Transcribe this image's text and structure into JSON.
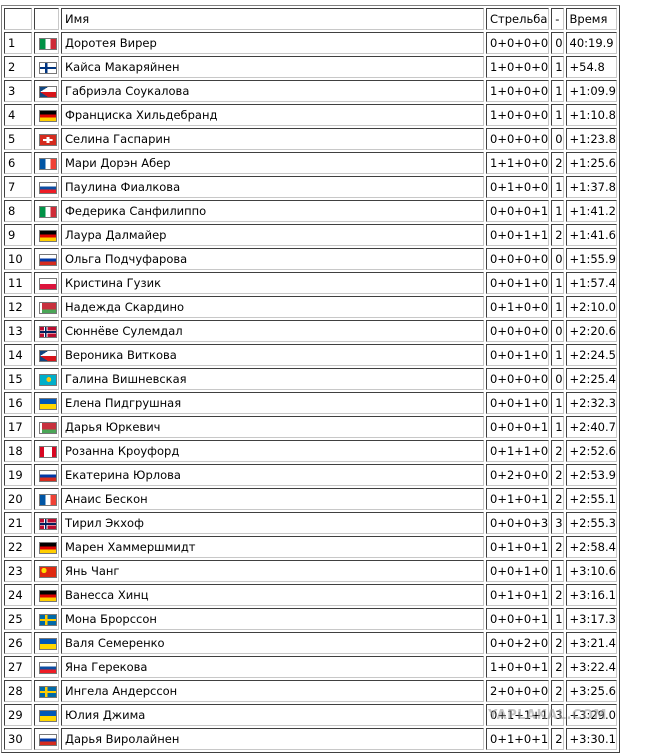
{
  "headers": {
    "place": "",
    "flag": "",
    "name": "Имя",
    "shooting": "Стрельба",
    "penalty": "-",
    "time": "Время"
  },
  "rows": [
    {
      "place": "1",
      "flag": "ITA",
      "name": "Доротея Вирер",
      "shooting": "0+0+0+0",
      "penalty": "0",
      "time": "40:19.9"
    },
    {
      "place": "2",
      "flag": "FIN",
      "name": "Кайса Макаряйнен",
      "shooting": "1+0+0+0",
      "penalty": "1",
      "time": "+54.8"
    },
    {
      "place": "3",
      "flag": "CZE",
      "name": "Габриэла Соукалова",
      "shooting": "1+0+0+0",
      "penalty": "1",
      "time": "+1:09.9"
    },
    {
      "place": "4",
      "flag": "GER",
      "name": "Франциска Хильдебранд",
      "shooting": "1+0+0+0",
      "penalty": "1",
      "time": "+1:10.8"
    },
    {
      "place": "5",
      "flag": "SUI",
      "name": "Селина Гаспарин",
      "shooting": "0+0+0+0",
      "penalty": "0",
      "time": "+1:23.8"
    },
    {
      "place": "6",
      "flag": "FRA",
      "name": "Мари Дорэн Абер",
      "shooting": "1+1+0+0",
      "penalty": "2",
      "time": "+1:25.6"
    },
    {
      "place": "7",
      "flag": "SVK",
      "name": "Паулина Фиалкова",
      "shooting": "0+1+0+0",
      "penalty": "1",
      "time": "+1:37.8"
    },
    {
      "place": "8",
      "flag": "ITA",
      "name": "Федерика Санфилиппо",
      "shooting": "0+0+0+1",
      "penalty": "1",
      "time": "+1:41.2"
    },
    {
      "place": "9",
      "flag": "GER",
      "name": "Лаура Далмайер",
      "shooting": "0+0+1+1",
      "penalty": "2",
      "time": "+1:41.6"
    },
    {
      "place": "10",
      "flag": "RUS",
      "name": "Ольга Подчуфарова",
      "shooting": "0+0+0+0",
      "penalty": "0",
      "time": "+1:55.9"
    },
    {
      "place": "11",
      "flag": "POL",
      "name": "Кристина Гузик",
      "shooting": "0+0+1+0",
      "penalty": "1",
      "time": "+1:57.4"
    },
    {
      "place": "12",
      "flag": "BLR",
      "name": "Надежда Скардино",
      "shooting": "0+1+0+0",
      "penalty": "1",
      "time": "+2:10.0"
    },
    {
      "place": "13",
      "flag": "NOR",
      "name": "Сюннёве Сулемдал",
      "shooting": "0+0+0+0",
      "penalty": "0",
      "time": "+2:20.6"
    },
    {
      "place": "14",
      "flag": "CZE",
      "name": "Вероника Виткова",
      "shooting": "0+0+1+0",
      "penalty": "1",
      "time": "+2:24.5"
    },
    {
      "place": "15",
      "flag": "KAZ",
      "name": "Галина Вишневская",
      "shooting": "0+0+0+0",
      "penalty": "0",
      "time": "+2:25.4"
    },
    {
      "place": "16",
      "flag": "UKR",
      "name": "Елена Пидгрушная",
      "shooting": "0+0+1+0",
      "penalty": "1",
      "time": "+2:32.3"
    },
    {
      "place": "17",
      "flag": "BLR",
      "name": "Дарья Юркевич",
      "shooting": "0+0+0+1",
      "penalty": "1",
      "time": "+2:40.7"
    },
    {
      "place": "18",
      "flag": "CAN",
      "name": "Розанна Кроуфорд",
      "shooting": "0+1+1+0",
      "penalty": "2",
      "time": "+2:52.6"
    },
    {
      "place": "19",
      "flag": "RUS",
      "name": "Екатерина Юрлова",
      "shooting": "0+2+0+0",
      "penalty": "2",
      "time": "+2:53.9"
    },
    {
      "place": "20",
      "flag": "FRA",
      "name": "Анаис Бескон",
      "shooting": "0+1+0+1",
      "penalty": "2",
      "time": "+2:55.1"
    },
    {
      "place": "21",
      "flag": "NOR",
      "name": "Тирил Экхоф",
      "shooting": "0+0+0+3",
      "penalty": "3",
      "time": "+2:55.3"
    },
    {
      "place": "22",
      "flag": "GER",
      "name": "Марен Хаммершмидт",
      "shooting": "0+1+0+1",
      "penalty": "2",
      "time": "+2:58.4"
    },
    {
      "place": "23",
      "flag": "CHN",
      "name": "Янь Чанг",
      "shooting": "0+0+1+0",
      "penalty": "1",
      "time": "+3:10.6"
    },
    {
      "place": "24",
      "flag": "GER",
      "name": "Ванесса Хинц",
      "shooting": "0+1+0+1",
      "penalty": "2",
      "time": "+3:16.1"
    },
    {
      "place": "25",
      "flag": "SWE",
      "name": "Мона Брорссон",
      "shooting": "0+0+0+1",
      "penalty": "1",
      "time": "+3:17.3"
    },
    {
      "place": "26",
      "flag": "UKR",
      "name": "Валя Семеренко",
      "shooting": "0+0+2+0",
      "penalty": "2",
      "time": "+3:21.4"
    },
    {
      "place": "27",
      "flag": "SVK",
      "name": "Яна Герекова",
      "shooting": "1+0+0+1",
      "penalty": "2",
      "time": "+3:22.4"
    },
    {
      "place": "28",
      "flag": "SWE",
      "name": "Ингела Андерссон",
      "shooting": "2+0+0+0",
      "penalty": "2",
      "time": "+3:25.6"
    },
    {
      "place": "29",
      "flag": "UKR",
      "name": "Юлия Джима",
      "shooting": "0+1+1+1",
      "penalty": "3",
      "time": "+3:29.0"
    },
    {
      "place": "30",
      "flag": "RUS",
      "name": "Дарья Виролайнен",
      "shooting": "0+1+0+1",
      "penalty": "2",
      "time": "+3:30.1"
    }
  ],
  "flag_colors": {
    "ITA": [
      "#009246",
      "#ffffff",
      "#ce2b37"
    ],
    "FIN": [
      "#ffffff",
      "#003580"
    ],
    "CZE": [
      "#ffffff",
      "#d7141a",
      "#11457e"
    ],
    "GER": [
      "#000000",
      "#dd0000",
      "#ffce00"
    ],
    "SUI": [
      "#d52b1e",
      "#ffffff"
    ],
    "FRA": [
      "#0055a4",
      "#ffffff",
      "#ef4135"
    ],
    "SVK": [
      "#ffffff",
      "#0b4ea2",
      "#ee1c25"
    ],
    "RUS": [
      "#ffffff",
      "#0039a6",
      "#d52b1e"
    ],
    "POL": [
      "#ffffff",
      "#dc143c"
    ],
    "BLR": [
      "#c8313e",
      "#4aa657",
      "#ffffff"
    ],
    "NOR": [
      "#ba0c2f",
      "#ffffff",
      "#00205b"
    ],
    "KAZ": [
      "#00afca",
      "#fec50c"
    ],
    "UKR": [
      "#0057b7",
      "#ffd700"
    ],
    "CAN": [
      "#d80621",
      "#ffffff"
    ],
    "CHN": [
      "#de2910",
      "#ffde00"
    ],
    "SWE": [
      "#006aa7",
      "#fecc00"
    ]
  },
  "watermark": "YAPLAKAL.COM"
}
